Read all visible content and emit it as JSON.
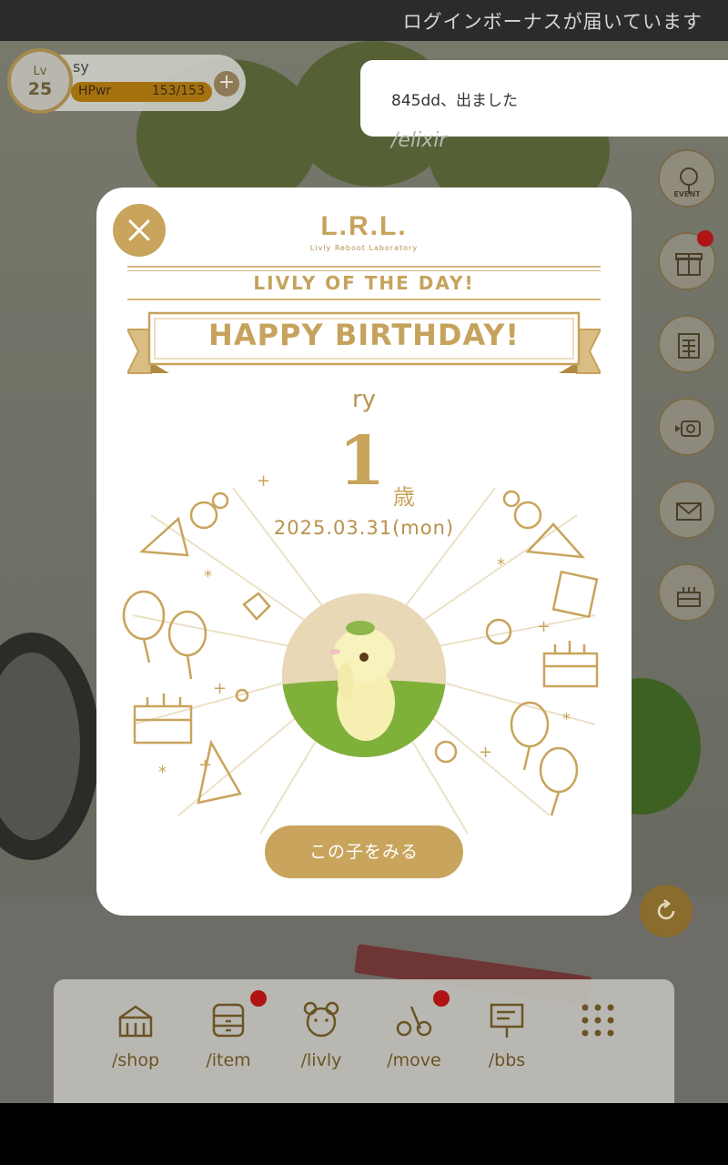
{
  "status_bar": {
    "message": "ログインボーナスが届いています"
  },
  "player": {
    "level_label": "Lv",
    "level": "25",
    "name": "sy",
    "hp_label": "HPwr",
    "hp_value": "153/153"
  },
  "toast": {
    "text": "845dd、出ました"
  },
  "room": {
    "label": "/elixir"
  },
  "side_menu": {
    "event_label": "EVENT"
  },
  "modal": {
    "brand": "L.R.L.",
    "brand_sub": "Livly Reboot Laboratory",
    "subtitle": "LIVLY OF THE DAY!",
    "banner": "HAPPY BIRTHDAY!",
    "livly_name": "ry",
    "age": "1",
    "age_unit": "歳",
    "date": "2025.03.31(mon)",
    "view_button": "この子をみる"
  },
  "bottom_nav": {
    "items": [
      {
        "label": "/shop",
        "icon": "tent-icon",
        "badge": false
      },
      {
        "label": "/item",
        "icon": "drawer-icon",
        "badge": true
      },
      {
        "label": "/livly",
        "icon": "bear-face-icon",
        "badge": false
      },
      {
        "label": "/move",
        "icon": "move-icon",
        "badge": true
      },
      {
        "label": "/bbs",
        "icon": "board-icon",
        "badge": false
      },
      {
        "label": "",
        "icon": "grid-dots-icon",
        "badge": false
      }
    ]
  },
  "colors": {
    "accent": "#c8a45c",
    "badge": "#b01414",
    "hp_bar": "#a6720f"
  }
}
